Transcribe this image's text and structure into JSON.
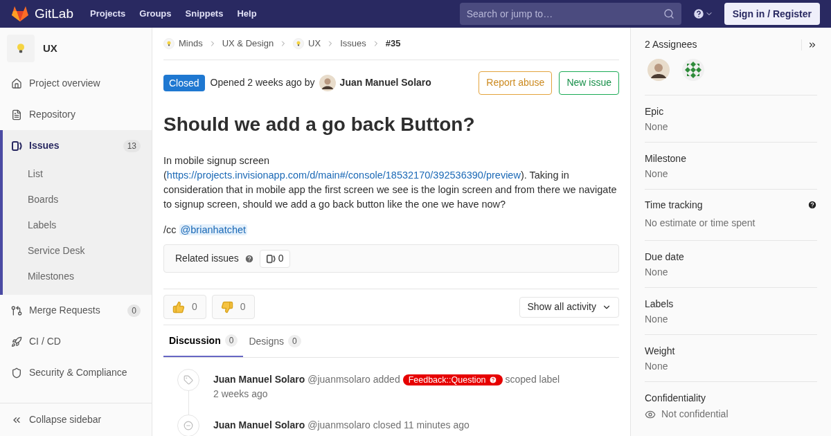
{
  "header": {
    "logo_text": "GitLab",
    "nav": [
      "Projects",
      "Groups",
      "Snippets",
      "Help"
    ],
    "search": {
      "placeholder": "Search or jump to…"
    },
    "sign_in": "Sign in / Register"
  },
  "sidebar": {
    "project_name": "UX",
    "items": [
      {
        "label": "Project overview",
        "kind": "home",
        "selected": false
      },
      {
        "label": "Repository",
        "kind": "repository",
        "selected": false
      },
      {
        "label": "Issues",
        "kind": "issues",
        "count": "13",
        "selected": true,
        "children": [
          {
            "label": "List"
          },
          {
            "label": "Boards"
          },
          {
            "label": "Labels"
          },
          {
            "label": "Service Desk"
          },
          {
            "label": "Milestones"
          }
        ]
      },
      {
        "label": "Merge Requests",
        "kind": "merge",
        "count": "0",
        "selected": false
      },
      {
        "label": "CI / CD",
        "kind": "cicd",
        "selected": false
      },
      {
        "label": "Security & Compliance",
        "kind": "security",
        "selected": false
      }
    ],
    "collapse": "Collapse sidebar"
  },
  "breadcrumbs": [
    {
      "label": "Minds",
      "avatar": true,
      "current": false
    },
    {
      "label": "UX & Design",
      "avatar": false,
      "current": false
    },
    {
      "label": "UX",
      "avatar": true,
      "current": false
    },
    {
      "label": "Issues",
      "avatar": false,
      "current": false
    },
    {
      "label": "#35",
      "avatar": false,
      "current": true
    }
  ],
  "issue": {
    "status": "Closed",
    "opened": "Opened 2 weeks ago by",
    "author": "Juan Manuel Solaro",
    "buttons": [
      {
        "label": "Report abuse",
        "kind": "warning"
      },
      {
        "label": "New issue",
        "kind": "success"
      }
    ],
    "title": "Should we add a go back Button?",
    "description": {
      "before": "In mobile signup screen (",
      "link": "https://projects.invisionapp.com/d/main#/console/18532170/392536390/preview",
      "after": "). Taking in consideration that in mobile app the first screen we see is the login screen and from there we navigate to signup screen, should we add a go back button like the one we have now?"
    },
    "cc": {
      "prefix": "/cc",
      "mention": "@brianhatchet"
    },
    "related": {
      "label": "Related issues",
      "count": "0"
    },
    "awards": [
      {
        "kind": "thumbsup",
        "count": "0"
      },
      {
        "kind": "thumbsdown",
        "count": "0"
      }
    ],
    "activity_filter": "Show all activity",
    "tabs": [
      {
        "label": "Discussion",
        "count": "0",
        "selected": true
      },
      {
        "label": "Designs",
        "count": "0",
        "selected": false
      }
    ],
    "notes": [
      {
        "kind": "tag",
        "author": "Juan Manuel Solaro",
        "handle": "@juanmsolaro",
        "action": "added",
        "label": {
          "text": "Feedback::Question",
          "color": "#e60000"
        },
        "after": "scoped label",
        "time": "2 weeks ago"
      },
      {
        "kind": "closed",
        "author": "Juan Manuel Solaro",
        "handle": "@juanmsolaro",
        "action": "closed 11 minutes ago"
      }
    ]
  },
  "right_sidebar": {
    "assignees_title": "2 Assignees",
    "assignees": [
      {
        "kind": "photo"
      },
      {
        "kind": "identicon"
      }
    ],
    "sections": [
      {
        "title": "Epic",
        "value": "None",
        "help": false
      },
      {
        "title": "Milestone",
        "value": "None",
        "help": false
      },
      {
        "title": "Time tracking",
        "value": "No estimate or time spent",
        "help": true
      },
      {
        "title": "Due date",
        "value": "None",
        "help": false
      },
      {
        "title": "Labels",
        "value": "None",
        "help": false
      },
      {
        "title": "Weight",
        "value": "None",
        "help": false
      }
    ],
    "confidentiality": {
      "title": "Confidentiality",
      "value": "Not confidential"
    }
  }
}
